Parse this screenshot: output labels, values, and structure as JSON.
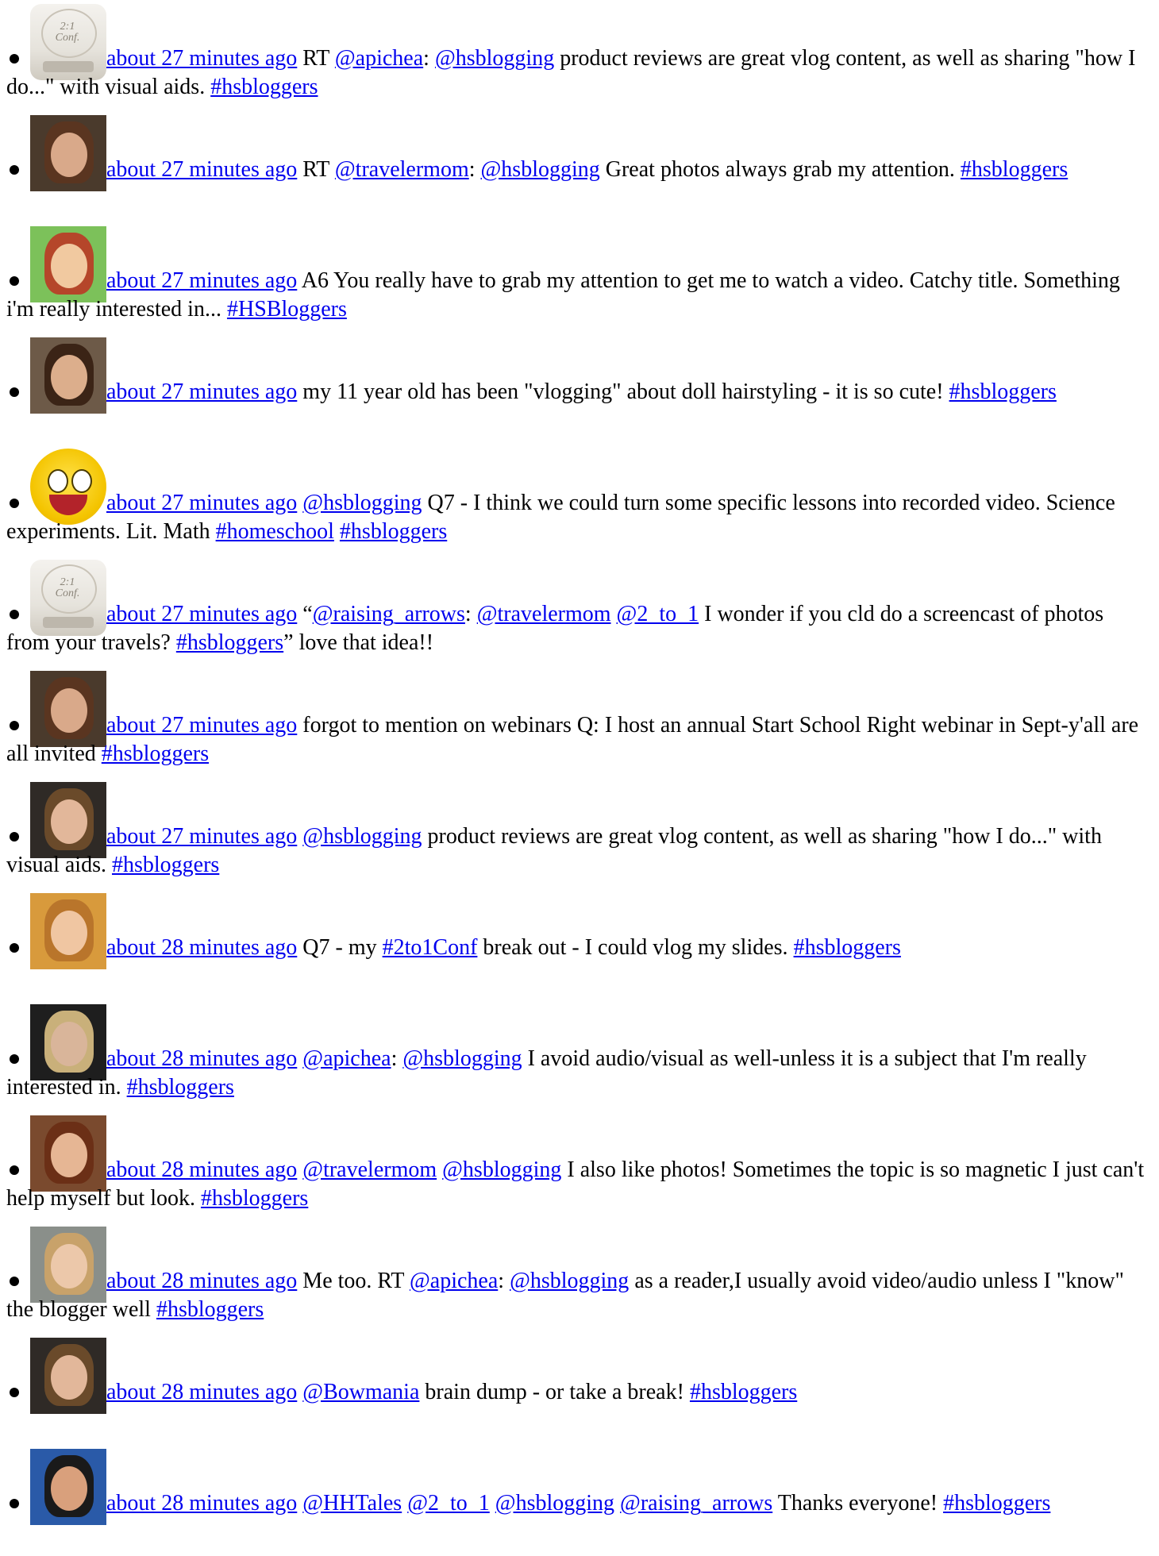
{
  "tweets": [
    {
      "avatar": {
        "name": "conference-logo-avatar",
        "kind": "conf"
      },
      "time": "about 27 minutes ago",
      "parts": [
        {
          "t": "RT "
        },
        {
          "l": "@apichea"
        },
        {
          "t": ": "
        },
        {
          "l": "@hsblogging"
        },
        {
          "t": " product reviews are great vlog content, as well as sharing \"how I do...\" with visual aids. "
        },
        {
          "l": "#hsbloggers"
        }
      ]
    },
    {
      "avatar": {
        "name": "user-photo-avatar",
        "kind": "photo",
        "bg": "#4a3a2c",
        "skin": "#d9a98a",
        "hair": "#5a3520"
      },
      "time": "about 27 minutes ago",
      "parts": [
        {
          "t": "RT "
        },
        {
          "l": "@travelermom"
        },
        {
          "t": ": "
        },
        {
          "l": "@hsblogging"
        },
        {
          "t": " Great photos always grab my attention. "
        },
        {
          "l": "#hsbloggers"
        }
      ]
    },
    {
      "avatar": {
        "name": "cartoon-avatar",
        "kind": "photo",
        "bg": "#7cc15a",
        "skin": "#f1c9a0",
        "hair": "#b5462a"
      },
      "time": "about 27 minutes ago",
      "parts": [
        {
          "t": "A6 You really have to grab my attention to get me to watch a video. Catchy title. Something i'm really interested in... "
        },
        {
          "l": "#HSBloggers"
        }
      ]
    },
    {
      "avatar": {
        "name": "user-photo-avatar",
        "kind": "photo",
        "bg": "#6d5a48",
        "skin": "#dcae8c",
        "hair": "#3b2416"
      },
      "time": "about 27 minutes ago",
      "parts": [
        {
          "t": "my 11 year old has been \"vlogging\" about doll hairstyling - it is so cute! "
        },
        {
          "l": "#hsbloggers"
        }
      ]
    },
    {
      "avatar": {
        "name": "smiley-avatar",
        "kind": "smile"
      },
      "time": "about 27 minutes ago",
      "parts": [
        {
          "l": "@hsblogging"
        },
        {
          "t": " Q7 - I think we could turn some specific lessons into recorded video. Science experiments. Lit. Math "
        },
        {
          "l": "#homeschool"
        },
        {
          "t": " "
        },
        {
          "l": "#hsbloggers"
        }
      ]
    },
    {
      "avatar": {
        "name": "conference-logo-avatar",
        "kind": "conf"
      },
      "time": "about 27 minutes ago",
      "parts": [
        {
          "t": "“"
        },
        {
          "l": "@raising_arrows"
        },
        {
          "t": ": "
        },
        {
          "l": "@travelermom"
        },
        {
          "t": " "
        },
        {
          "l": "@2_to_1"
        },
        {
          "t": " I wonder if you cld do a screencast of photos from your travels? "
        },
        {
          "l": "#hsbloggers"
        },
        {
          "t": "” love that idea!!"
        }
      ]
    },
    {
      "avatar": {
        "name": "user-photo-avatar",
        "kind": "photo",
        "bg": "#4a3a2c",
        "skin": "#d9a98a",
        "hair": "#5a3520"
      },
      "time": "about 27 minutes ago",
      "parts": [
        {
          "t": "forgot to mention on webinars Q: I host an annual Start School Right webinar in Sept-y'all are all invited "
        },
        {
          "l": "#hsbloggers"
        }
      ]
    },
    {
      "avatar": {
        "name": "user-photo-avatar",
        "kind": "photo",
        "bg": "#2f2a26",
        "skin": "#e2b79a",
        "hair": "#6a4a2a"
      },
      "time": "about 27 minutes ago",
      "parts": [
        {
          "l": "@hsblogging"
        },
        {
          "t": " product reviews are great vlog content, as well as sharing \"how I do...\" with visual aids. "
        },
        {
          "l": "#hsbloggers"
        }
      ]
    },
    {
      "avatar": {
        "name": "user-photo-avatar",
        "kind": "photo",
        "bg": "#d89a3c",
        "skin": "#f0c6a2",
        "hair": "#b9752b"
      },
      "time": "about 28 minutes ago",
      "parts": [
        {
          "t": "Q7 - my "
        },
        {
          "l": "#2to1Conf"
        },
        {
          "t": " break out - I could vlog my slides. "
        },
        {
          "l": "#hsbloggers"
        }
      ]
    },
    {
      "avatar": {
        "name": "user-photo-avatar",
        "kind": "photo",
        "bg": "#1e1e1e",
        "skin": "#d9b59a",
        "hair": "#c9b07a"
      },
      "time": "about 28 minutes ago",
      "parts": [
        {
          "l": "@apichea"
        },
        {
          "t": ": "
        },
        {
          "l": "@hsblogging"
        },
        {
          "t": " I avoid audio/visual as well-unless it is a subject that I'm really interested in. "
        },
        {
          "l": "#hsbloggers"
        }
      ]
    },
    {
      "avatar": {
        "name": "user-photo-avatar",
        "kind": "photo",
        "bg": "#7a4a2e",
        "skin": "#e6b694",
        "hair": "#6b2f16"
      },
      "time": "about 28 minutes ago",
      "parts": [
        {
          "l": "@travelermom"
        },
        {
          "t": " "
        },
        {
          "l": "@hsblogging"
        },
        {
          "t": " I also like photos! Sometimes the topic is so magnetic I just can't help myself but look. "
        },
        {
          "l": "#hsbloggers"
        }
      ]
    },
    {
      "avatar": {
        "name": "user-photo-avatar",
        "kind": "photo",
        "bg": "#8a8f8a",
        "skin": "#ecc8aa",
        "hair": "#c8a26a"
      },
      "time": "about 28 minutes ago",
      "parts": [
        {
          "t": "Me too. RT "
        },
        {
          "l": "@apichea"
        },
        {
          "t": ": "
        },
        {
          "l": "@hsblogging"
        },
        {
          "t": " as a reader,I usually avoid video/audio unless I \"know\" the blogger well "
        },
        {
          "l": "#hsbloggers"
        }
      ]
    },
    {
      "avatar": {
        "name": "user-photo-avatar",
        "kind": "photo",
        "bg": "#2f2a26",
        "skin": "#e2b79a",
        "hair": "#6a4a2a"
      },
      "time": "about 28 minutes ago",
      "parts": [
        {
          "l": "@Bowmania"
        },
        {
          "t": " brain dump - or take a break! "
        },
        {
          "l": "#hsbloggers"
        }
      ]
    },
    {
      "avatar": {
        "name": "user-photo-avatar",
        "kind": "photo",
        "bg": "#2a5aa8",
        "skin": "#d9a07c",
        "hair": "#1a1a1a"
      },
      "time": "about 28 minutes ago",
      "parts": [
        {
          "l": "@HHTales"
        },
        {
          "t": " "
        },
        {
          "l": "@2_to_1"
        },
        {
          "t": " "
        },
        {
          "l": "@hsblogging"
        },
        {
          "t": " "
        },
        {
          "l": "@raising_arrows"
        },
        {
          "t": " Thanks everyone! "
        },
        {
          "l": "#hsbloggers"
        }
      ]
    }
  ]
}
